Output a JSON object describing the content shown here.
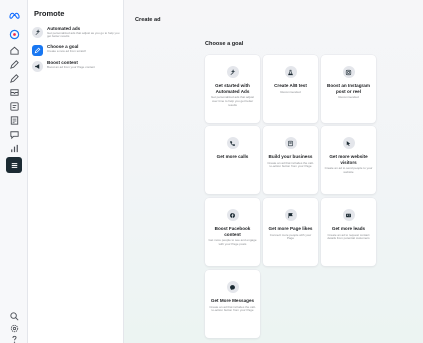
{
  "app": {
    "logo_icon": "meta-logo-icon",
    "accent": "#1877f2"
  },
  "sidebar": {
    "title": "Promote",
    "items": [
      {
        "title": "Automated ads",
        "description": "Get personalized ads that adjust as you go to help you get better results",
        "icon": "sparkle-icon",
        "selected": false
      },
      {
        "title": "Choose a goal",
        "description": "Create a new ad from scratch",
        "icon": "pencil-icon",
        "selected": true
      },
      {
        "title": "Boost content",
        "description": "Boost an ad from your Page content",
        "icon": "megaphone-icon",
        "selected": false
      }
    ]
  },
  "main": {
    "title": "Create ad",
    "goals_heading": "Choose a goal",
    "goals": [
      {
        "title": "Get started with Automated Ads",
        "description": "Get personalized ads that adjust over time to help you get better results",
        "icon": "sparkle-icon"
      },
      {
        "title": "Create A/B test",
        "description": "Recommended",
        "icon": "flask-icon"
      },
      {
        "title": "Boost an Instagram post or reel",
        "description": "Recommended",
        "icon": "instagram-icon"
      },
      {
        "title": "Get more calls",
        "description": "",
        "icon": "phone-icon"
      },
      {
        "title": "Build your business",
        "description": "Create an ad that includes the call-to-action button from your Page",
        "icon": "storefront-icon"
      },
      {
        "title": "Get more website visitors",
        "description": "Create an ad to send people to your website",
        "icon": "cursor-icon"
      },
      {
        "title": "Boost Facebook content",
        "description": "Get more people to see and engage with your Page posts",
        "icon": "facebook-icon"
      },
      {
        "title": "Get more Page likes",
        "description": "Connect more people with your Page",
        "icon": "flag-icon"
      },
      {
        "title": "Get more leads",
        "description": "Create an ad to request contact details from potential customers",
        "icon": "id-card-icon"
      },
      {
        "title": "Get More Messages",
        "description": "Create an ad that includes the call-to-action button from your Page",
        "icon": "chat-icon"
      }
    ]
  }
}
